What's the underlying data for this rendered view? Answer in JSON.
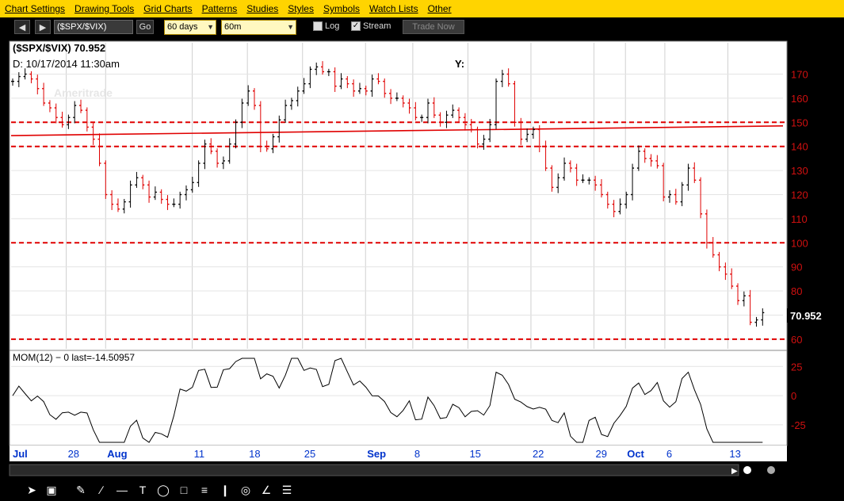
{
  "menu": [
    "Chart Settings",
    "Drawing Tools",
    "Grid Charts",
    "Patterns",
    "Studies",
    "Styles",
    "Symbols",
    "Watch Lists",
    "Other"
  ],
  "toolbar": {
    "symbol": "($SPX/$VIX)",
    "go_label": "Go",
    "period": "60 days",
    "interval": "60m",
    "log_label": "Log",
    "log_checked": false,
    "stream_label": "Stream",
    "stream_checked": true,
    "trade_now_label": "Trade Now"
  },
  "header": {
    "symbol_value": "($SPX/$VIX)  70.952",
    "date_label": "D:  10/17/2014  11:30am",
    "y_label": "Y:",
    "watermark": "Ameritrade"
  },
  "price_tag": "70.952",
  "indicator_label": "MOM(12) − 0  last=-14.50957",
  "colors": {
    "up": "#000000",
    "down": "#e00000",
    "hline": "#e00000",
    "background": "#ffffff",
    "accent": "#ffd400"
  },
  "chart_data": {
    "type": "candlestick",
    "title": "($SPX/$VIX)",
    "y_ticks": [
      60,
      70,
      80,
      90,
      100,
      110,
      120,
      130,
      140,
      150,
      160,
      170
    ],
    "ylim": [
      56,
      183
    ],
    "x_ticks": [
      "Jul",
      "28",
      "Aug",
      "11",
      "18",
      "25",
      "Sep",
      "8",
      "15",
      "22",
      "29",
      "Oct",
      "6",
      "13"
    ],
    "x_tick_positions": [
      0,
      7,
      12,
      23,
      30,
      37,
      45,
      51,
      58,
      66,
      74,
      78,
      83,
      91
    ],
    "xlim": [
      0,
      98
    ],
    "horizontal_lines": [
      150,
      140,
      100,
      60
    ],
    "trendline": {
      "from": [
        0,
        144.5
      ],
      "to": [
        98,
        148.5
      ]
    },
    "series": [
      {
        "values": [
          167,
          169,
          170,
          168,
          164,
          158,
          156,
          152,
          149,
          152,
          157,
          155,
          148,
          143,
          133,
          120,
          116,
          114,
          117,
          124,
          127,
          124,
          119,
          121,
          118,
          116,
          116,
          120,
          122,
          125,
          133,
          141,
          138,
          133,
          134,
          141,
          150,
          158,
          163,
          157,
          140,
          139,
          144,
          151,
          157,
          159,
          163,
          166,
          172,
          173,
          171,
          171,
          165,
          168,
          166,
          163,
          164,
          163,
          168,
          167,
          162,
          160,
          160,
          158,
          156,
          152,
          152,
          158,
          153,
          150,
          153,
          155,
          152,
          149,
          147,
          141,
          143,
          149,
          167,
          170,
          166,
          150,
          143,
          145,
          147,
          140,
          131,
          123,
          127,
          133,
          131,
          126,
          126,
          126,
          124,
          120,
          116,
          113,
          116,
          120,
          131,
          138,
          135,
          134,
          132,
          119,
          120,
          117,
          124,
          131,
          126,
          112,
          100,
          95,
          90,
          87,
          82,
          76,
          78,
          67,
          68,
          71
        ]
      }
    ],
    "momentum": {
      "label": "MOM(12)",
      "last": -14.50957,
      "y_ticks": [
        25,
        0,
        -25
      ],
      "ylim": [
        -40,
        32
      ]
    }
  }
}
